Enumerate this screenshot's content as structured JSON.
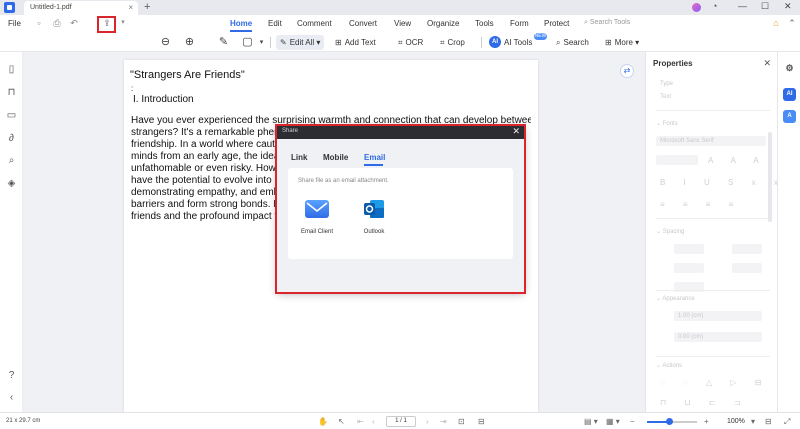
{
  "window": {
    "tab_title": "Untitled-1.pdf",
    "new_tab": "+"
  },
  "menu": {
    "file": "File",
    "tabs": [
      "Home",
      "Edit",
      "Comment",
      "Convert",
      "View",
      "Organize",
      "Tools",
      "Form",
      "Protect"
    ],
    "active_tab": "Home",
    "search_placeholder": "Search Tools"
  },
  "toolbar": {
    "edit_all": "Edit All",
    "add_text": "Add Text",
    "ocr": "OCR",
    "crop": "Crop",
    "ai_tools": "AI Tools",
    "ai_badge": "AI",
    "new_badge": "NEW",
    "search": "Search",
    "more": "More"
  },
  "document": {
    "title": "\"Strangers Are Friends\"",
    "colon": ":",
    "heading": "I. Introduction",
    "paragraph_lines": [
      "Have you ever experienced the surprising warmth and connection that can develop between",
      "strangers? It's a remarkable phen",
      "friendship. In a world where cautio",
      "minds from an early age, the idea",
      "unfathomable or even risky. Howe",
      "have the potential to evolve into m",
      "demonstrating empathy, and emb",
      "barriers and form strong bonds. In",
      "friends and the profound impact th"
    ]
  },
  "dialog": {
    "title": "Share",
    "tabs": [
      "Link",
      "Mobile",
      "Email"
    ],
    "active_tab": "Email",
    "description": "Share file as an email attachment.",
    "options": [
      {
        "label": "Email Client",
        "icon": "mail-icon"
      },
      {
        "label": "Outlook",
        "icon": "outlook-icon"
      }
    ]
  },
  "properties": {
    "title": "Properties",
    "type_label": "Type",
    "type_value": "Text",
    "font_section": "Fonts",
    "font_name": "Microsoft Sans Serif",
    "spacing_section": "Spacing",
    "appearance_section": "Appearance",
    "appearance_value_1": "1.00 (cm)",
    "appearance_value_2": "0.00 (cm)",
    "actions_section": "Actions"
  },
  "status": {
    "page_size": "21 x 29.7 cm",
    "page_indicator": "1 / 1",
    "zoom": "100%"
  },
  "colors": {
    "accent": "#2f6be6",
    "highlight_red": "#d9252b",
    "dialog_header": "#2c2d33"
  }
}
